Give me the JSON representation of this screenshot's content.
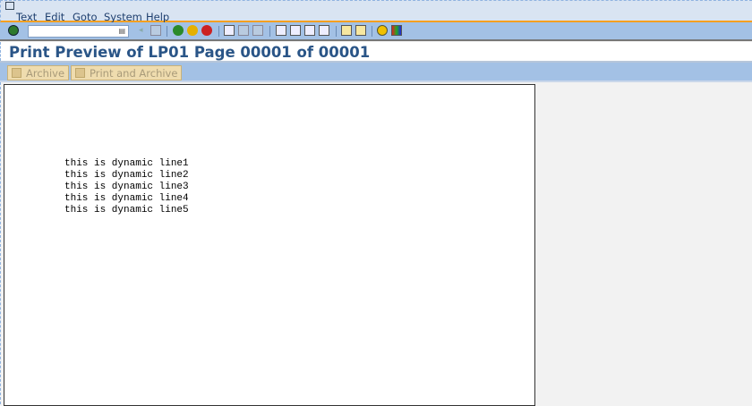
{
  "menu": {
    "items": [
      "Text",
      "Edit",
      "Goto",
      "System",
      "Help"
    ]
  },
  "toolbar": {
    "command_field_value": "",
    "icons": [
      "enter-icon",
      "back-icon",
      "exit-icon",
      "cancel-icon",
      "print-icon",
      "find-icon",
      "find-next-icon",
      "first-page-icon",
      "previous-page-icon",
      "next-page-icon",
      "last-page-icon",
      "new-session-icon",
      "shortcut-icon",
      "help-icon",
      "layout-icon"
    ]
  },
  "title": "Print Preview of LP01 Page 00001 of 00001",
  "app_toolbar": {
    "archive": "Archive",
    "print_and_archive": "Print and Archive"
  },
  "page": {
    "lines": [
      "this is dynamic line1",
      "this is dynamic line2",
      "this is dynamic line3",
      "this is dynamic line4",
      "this is dynamic line5"
    ]
  }
}
